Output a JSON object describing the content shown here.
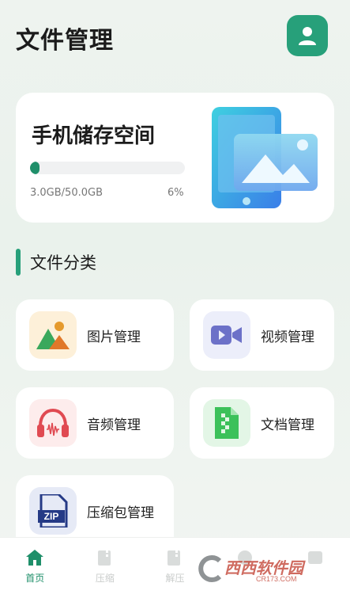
{
  "header": {
    "title": "文件管理"
  },
  "storage": {
    "title": "手机储存空间",
    "used_text": "3.0GB/50.0GB",
    "percent_text": "6%",
    "percent_value": 6
  },
  "section": {
    "label": "文件分类"
  },
  "categories": [
    {
      "label": "图片管理",
      "icon": "image-icon"
    },
    {
      "label": "视频管理",
      "icon": "video-icon"
    },
    {
      "label": "音频管理",
      "icon": "headphones-icon"
    },
    {
      "label": "文档管理",
      "icon": "document-icon"
    },
    {
      "label": "压缩包管理",
      "icon": "zip-icon"
    }
  ],
  "tabbar": {
    "items": [
      {
        "label": "首页",
        "icon": "home-icon",
        "active": true
      },
      {
        "label": "压缩",
        "icon": "compress-icon",
        "active": false
      },
      {
        "label": "解压",
        "icon": "extract-icon",
        "active": false
      },
      {
        "label": "",
        "icon": "transfer-icon",
        "active": false
      },
      {
        "label": "",
        "icon": "tools-icon",
        "active": false
      }
    ]
  },
  "watermark": {
    "text": "西西软件园",
    "sub": "CR173.COM"
  },
  "colors": {
    "accent": "#27a07a",
    "active_tab": "#1f8f6a",
    "inactive_tab": "#c9cccb"
  }
}
